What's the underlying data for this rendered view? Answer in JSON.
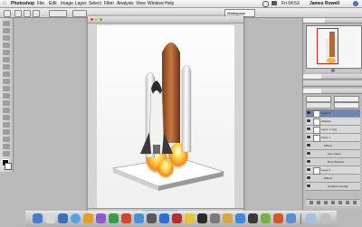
{
  "menubar": {
    "apple": "",
    "app": "Photoshop",
    "items": [
      "File",
      "Edit",
      "Image",
      "Layer",
      "Select",
      "Filter",
      "Analysis",
      "View",
      "Window",
      "Help"
    ],
    "clock": "Fri 04:53",
    "user": "James Rowell"
  },
  "optionsbar": {
    "workspace": "Workspace"
  },
  "layers": {
    "rows": [
      "Layer 3",
      "Shadow",
      "Layer 1 copy",
      "Layer 1",
      "Effects",
      "Inner Glow",
      "Drop Shadow",
      "Layer 2",
      "Effects",
      "Gradient Overlay"
    ]
  },
  "colors": {
    "accent": "#6f86b0",
    "nav_box": "#d21e1e"
  }
}
